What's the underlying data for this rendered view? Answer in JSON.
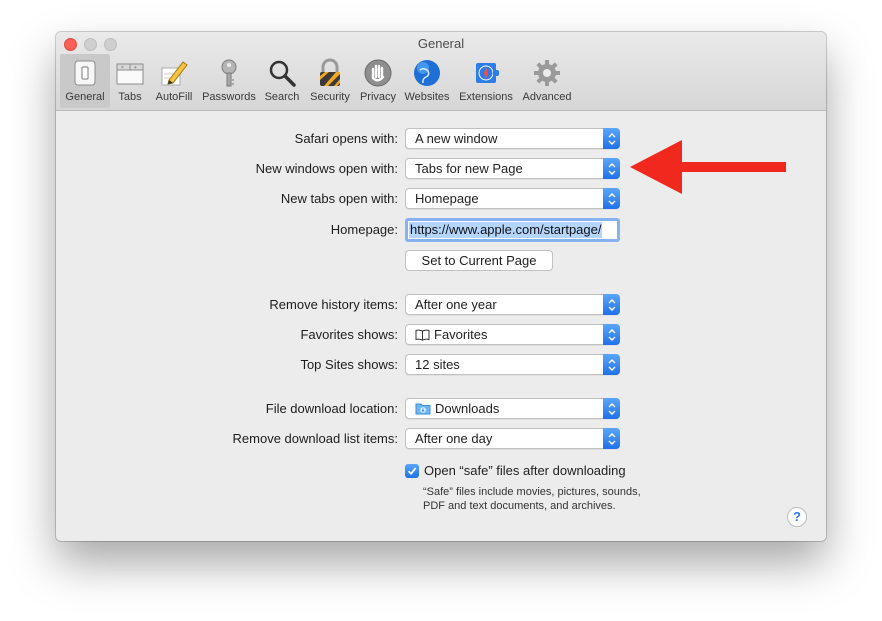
{
  "window": {
    "title": "General"
  },
  "toolbar": {
    "tabs": [
      {
        "label": "General",
        "icon": "switch-icon"
      },
      {
        "label": "Tabs",
        "icon": "tabs-icon"
      },
      {
        "label": "AutoFill",
        "icon": "pencil-icon"
      },
      {
        "label": "Passwords",
        "icon": "key-icon"
      },
      {
        "label": "Search",
        "icon": "magnifier-icon"
      },
      {
        "label": "Security",
        "icon": "padlock-icon"
      },
      {
        "label": "Privacy",
        "icon": "hand-icon"
      },
      {
        "label": "Websites",
        "icon": "globe-icon"
      },
      {
        "label": "Extensions",
        "icon": "puzzle-icon"
      },
      {
        "label": "Advanced",
        "icon": "gear-icon"
      }
    ],
    "selected": "General"
  },
  "settings": {
    "safari_opens_with": {
      "label": "Safari opens with:",
      "value": "A new window"
    },
    "new_windows_open_with": {
      "label": "New windows open with:",
      "value": "Tabs for new Page"
    },
    "new_tabs_open_with": {
      "label": "New tabs open with:",
      "value": "Homepage"
    },
    "homepage": {
      "label": "Homepage:",
      "value": "https://www.apple.com/startpage/"
    },
    "set_current_button": "Set to Current Page",
    "remove_history": {
      "label": "Remove history items:",
      "value": "After one year"
    },
    "favorites_shows": {
      "label": "Favorites shows:",
      "value": "Favorites"
    },
    "top_sites_shows": {
      "label": "Top Sites shows:",
      "value": "12 sites"
    },
    "download_location": {
      "label": "File download location:",
      "value": "Downloads"
    },
    "remove_download_list": {
      "label": "Remove download list items:",
      "value": "After one day"
    },
    "open_safe_files": {
      "label": "Open “safe” files after downloading",
      "checked": true
    },
    "safe_files_hint": "“Safe” files include movies, pictures, sounds, PDF and text documents, and archives.",
    "help_symbol": "?"
  },
  "colors": {
    "accent": "#1f71e8",
    "arrow": "#f0281e",
    "selection": "#b4d5fe"
  }
}
